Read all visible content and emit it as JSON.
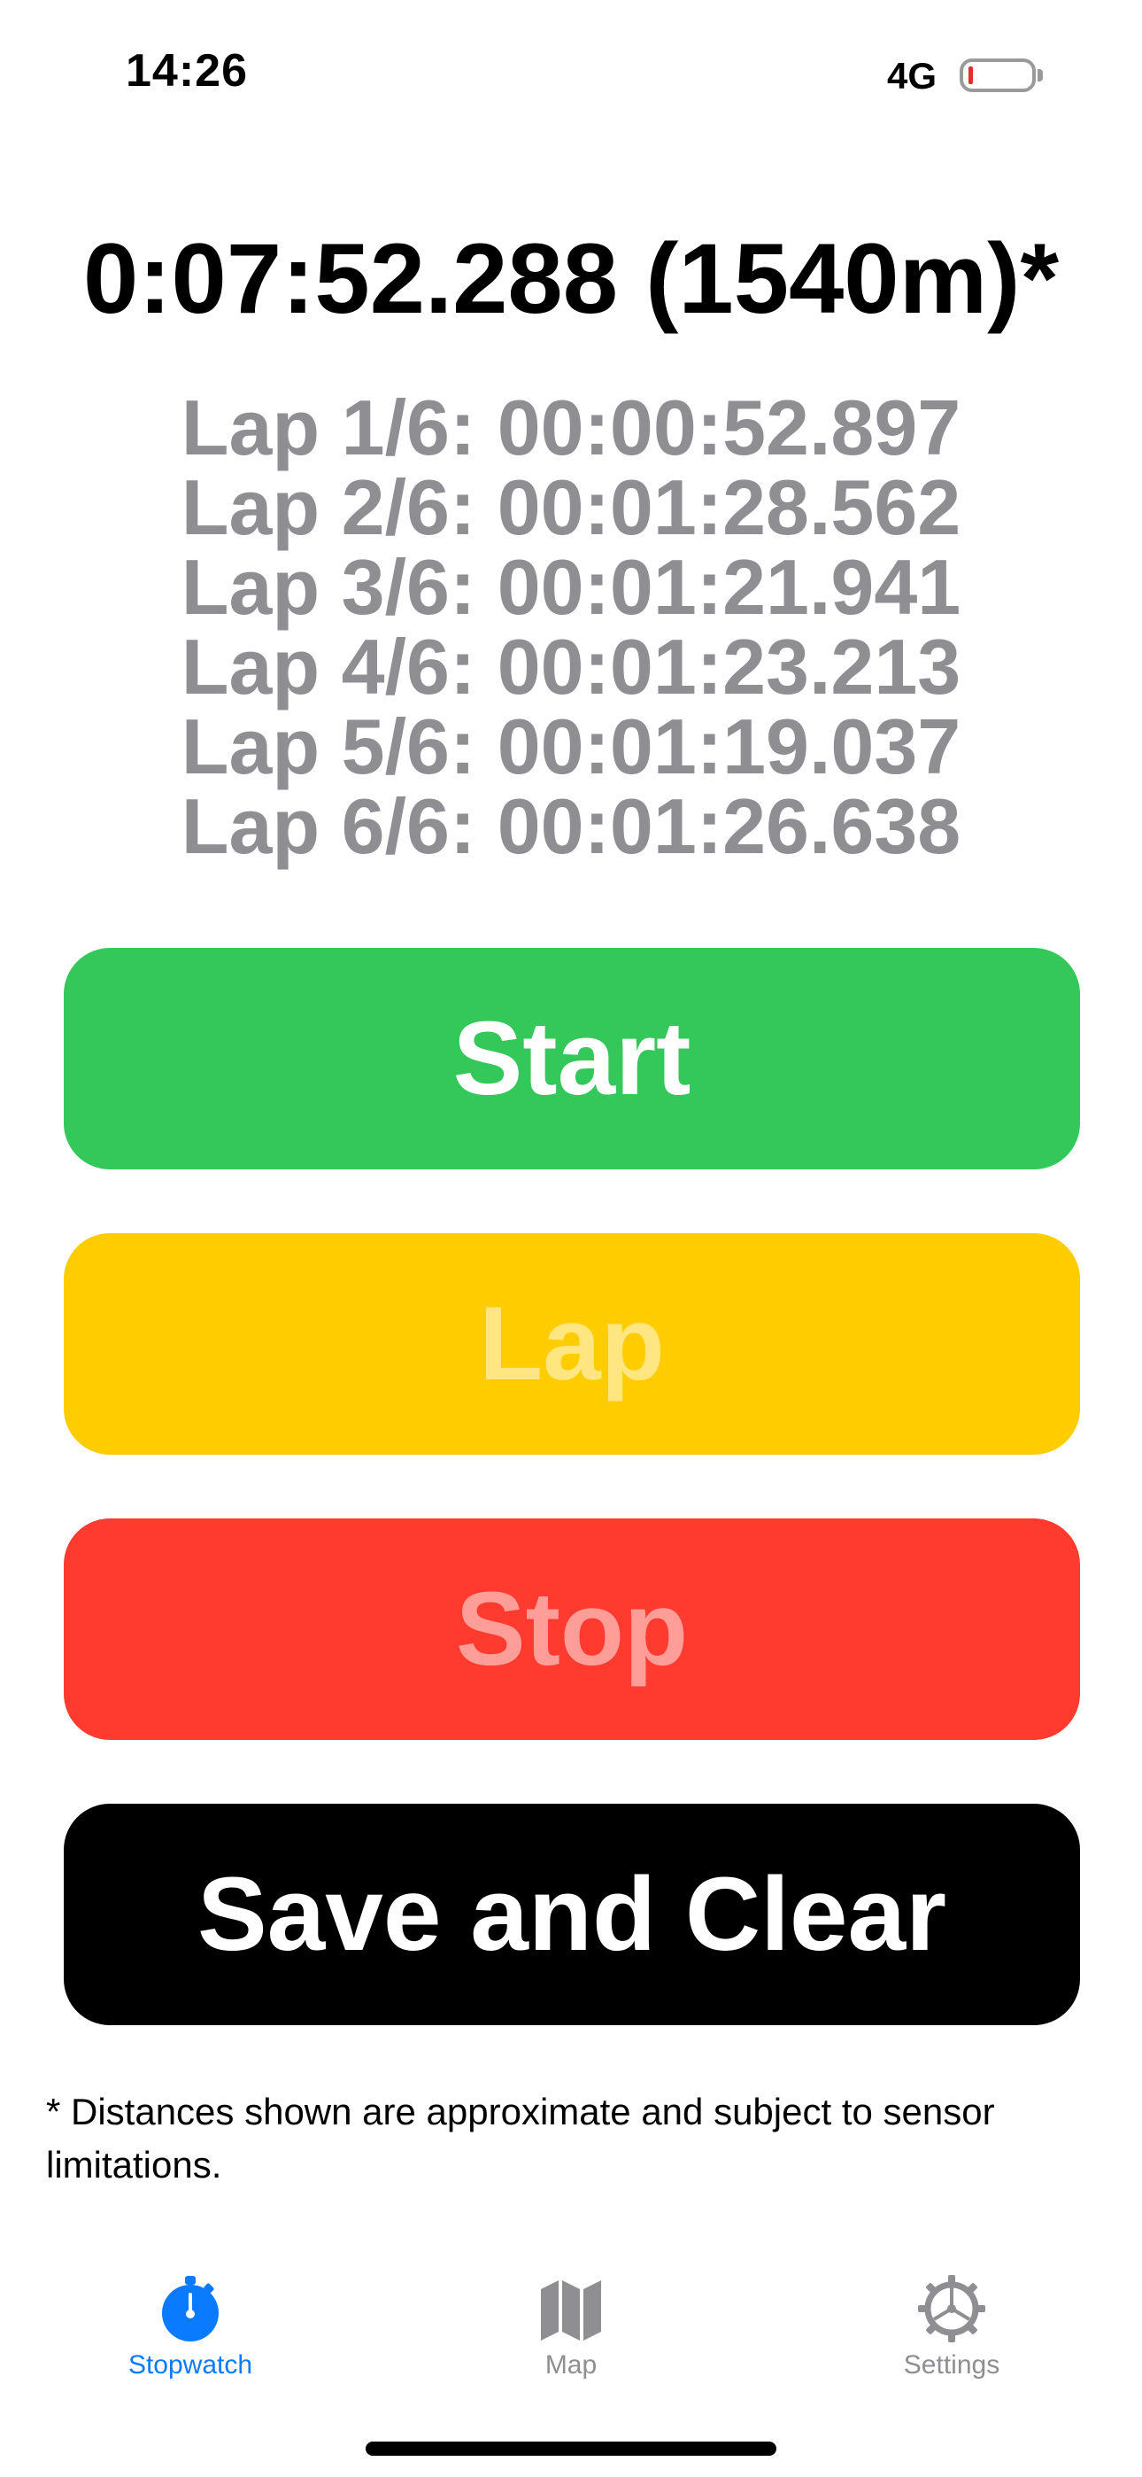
{
  "status_bar": {
    "time": "14:26",
    "network": "4G",
    "battery_level": 0.05,
    "battery_color": "#e0302a"
  },
  "timer": {
    "display": "0:07:52.288 (1540m)*"
  },
  "laps": [
    "Lap 1/6: 00:00:52.897",
    "Lap 2/6: 00:01:28.562",
    "Lap 3/6: 00:01:21.941",
    "Lap 4/6: 00:01:23.213",
    "Lap 5/6: 00:01:19.037",
    "Lap 6/6: 00:01:26.638"
  ],
  "buttons": {
    "start": {
      "label": "Start",
      "color": "#34c759"
    },
    "lap": {
      "label": "Lap",
      "color": "#ffcc00"
    },
    "stop": {
      "label": "Stop",
      "color": "#ff3b30"
    },
    "save": {
      "label": "Save and Clear",
      "color": "#000000"
    }
  },
  "footnote": "* Distances shown are approximate and subject to sensor limitations.",
  "tabbar": {
    "accent_color": "#0a7aff",
    "inactive_color": "#8e8e93",
    "tabs": [
      {
        "label": "Stopwatch",
        "icon": "stopwatch-icon",
        "active": true
      },
      {
        "label": "Map",
        "icon": "map-icon",
        "active": false
      },
      {
        "label": "Settings",
        "icon": "gear-icon",
        "active": false
      }
    ]
  }
}
